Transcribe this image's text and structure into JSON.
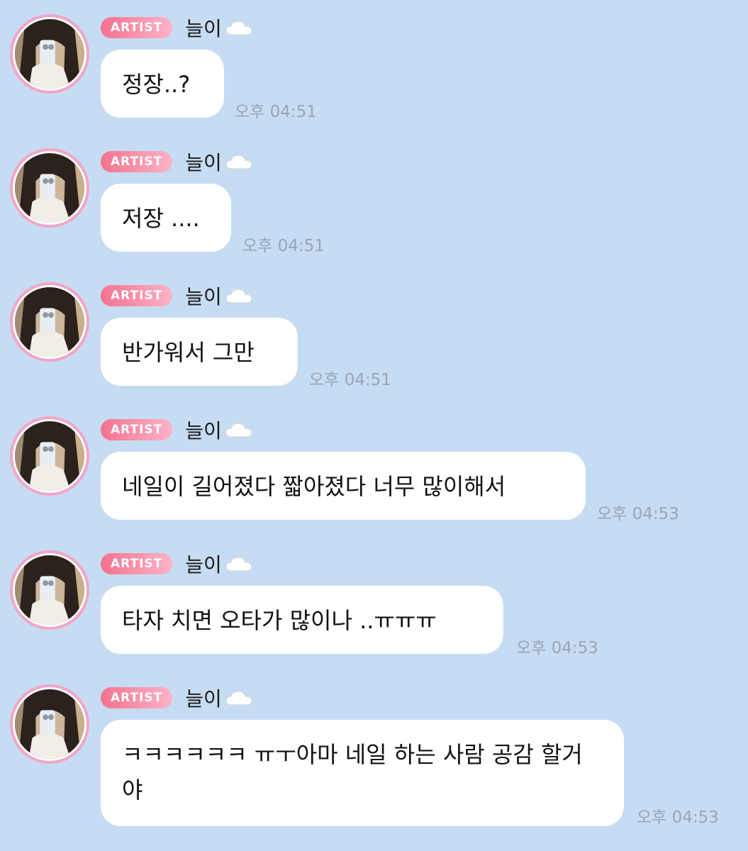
{
  "messages": [
    {
      "badge": "ARTIST",
      "sender": "늘이",
      "icon": "cloud-icon",
      "text": "정장..?",
      "time": "오후 04:51"
    },
    {
      "badge": "ARTIST",
      "sender": "늘이",
      "icon": "cloud-icon",
      "text": "저장 ....",
      "time": "오후 04:51"
    },
    {
      "badge": "ARTIST",
      "sender": "늘이",
      "icon": "cloud-icon",
      "text": "반가워서 그만",
      "time": "오후 04:51"
    },
    {
      "badge": "ARTIST",
      "sender": "늘이",
      "icon": "cloud-icon",
      "text": "네일이 길어졌다 짧아졌다 너무 많이해서",
      "time": "오후 04:53"
    },
    {
      "badge": "ARTIST",
      "sender": "늘이",
      "icon": "cloud-icon",
      "text": "타자 치면 오타가 많이나 ..ㅠㅠㅠ",
      "time": "오후 04:53"
    },
    {
      "badge": "ARTIST",
      "sender": "늘이",
      "icon": "cloud-icon",
      "text": "ㅋㅋㅋㅋㅋㅋ ㅠㅜ아마 네일 하는 사람 공감 할거야",
      "time": "오후 04:53"
    }
  ],
  "colors": {
    "background": "#c6dcf2",
    "badge_start": "#f4728f",
    "badge_end": "#fdb3c8",
    "avatar_ring": "#f2a5c8",
    "bubble": "#ffffff",
    "time": "#9aa6b5"
  }
}
